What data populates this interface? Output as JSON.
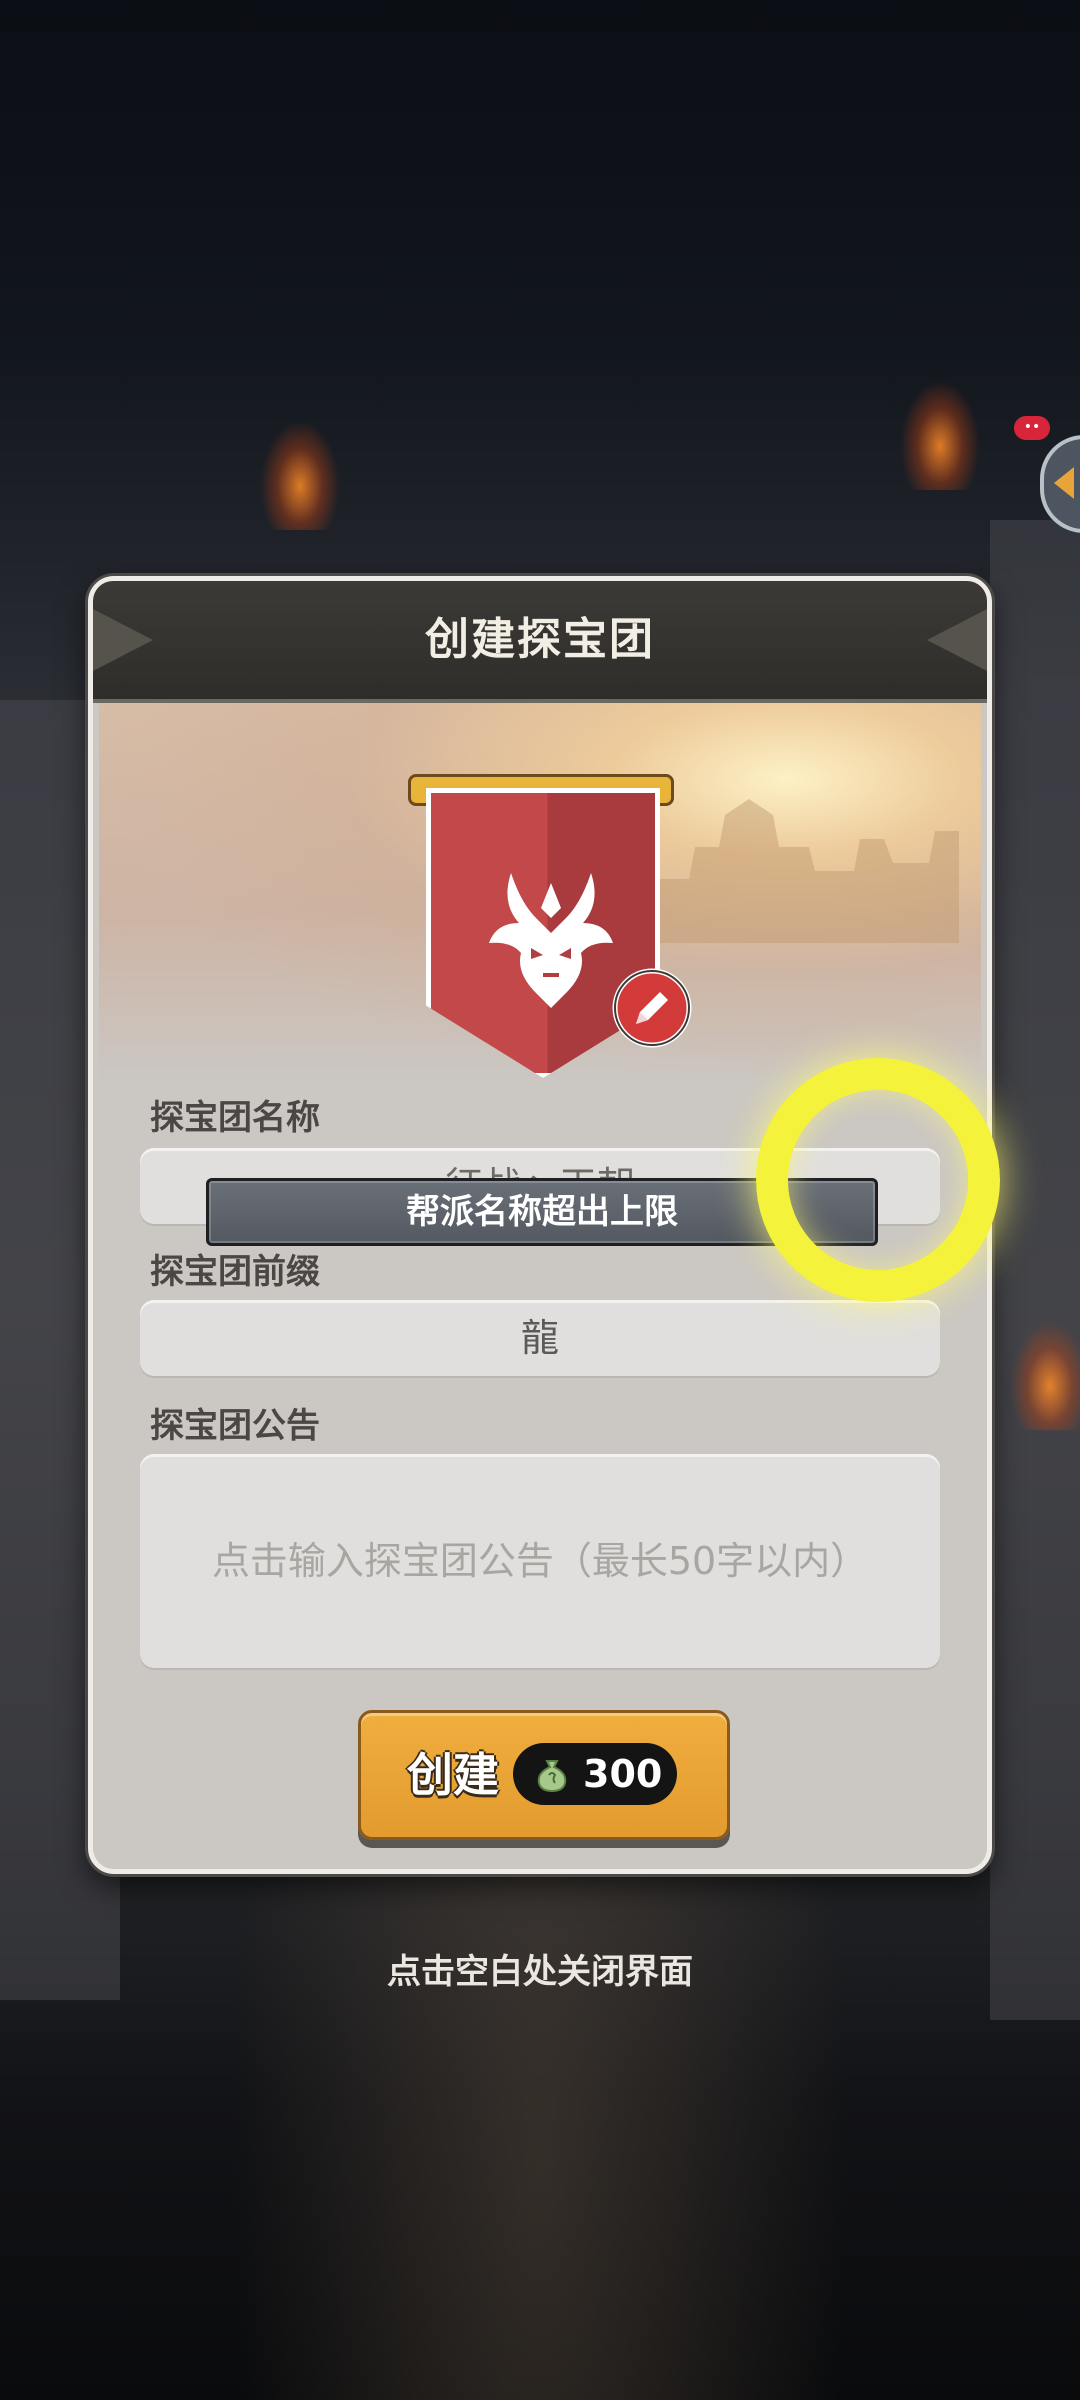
{
  "dialog": {
    "title": "创建探宝团"
  },
  "form": {
    "name_label": "探宝团名称",
    "name_value": "征战丶王朝",
    "prefix_label": "探宝团前缀",
    "prefix_value": "龍",
    "notice_label": "探宝团公告",
    "notice_placeholder": "点击输入探宝团公告（最长50字以内）"
  },
  "toast": {
    "message": "帮派名称超出上限"
  },
  "create_button": {
    "label": "创建",
    "cost": "300",
    "cost_icon": "money-bag-icon"
  },
  "close_hint": "点击空白处关闭界面",
  "colors": {
    "accent_orange": "#e39b2e",
    "banner_red": "#c2484a",
    "highlight_yellow": "#f4f23a",
    "header_dark": "#2f2d2a"
  }
}
